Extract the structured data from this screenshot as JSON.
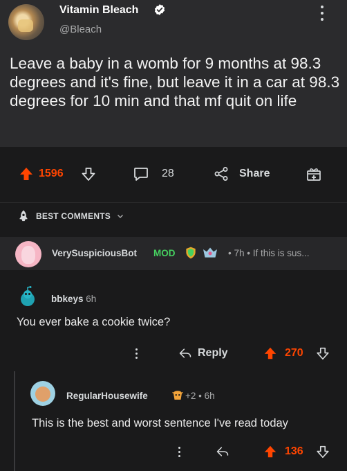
{
  "tweet": {
    "display_name": "Vitamin Bleach",
    "handle": "@Bleach",
    "text": "Leave a baby in a womb for 9 months at 98.3 degrees and it's fine, but leave it in a car at 98.3 degrees for 10 min and that mf quit on life"
  },
  "post_actions": {
    "upvotes": "1596",
    "comments": "28",
    "share_label": "Share"
  },
  "best_comments": {
    "label": "BEST COMMENTS"
  },
  "comments": [
    {
      "username": "VerySuspiciousBot",
      "flair": "MOD",
      "meta": "• 7h • If this is sus..."
    },
    {
      "username": "bbkeys",
      "age": "6h",
      "text": "You ever bake a cookie twice?",
      "reply_label": "Reply",
      "score": "270"
    },
    {
      "username": "RegularHousewife",
      "meta": "+2 • 6h",
      "text": "This is the best and worst sentence I've read today",
      "score": "136"
    }
  ],
  "colors": {
    "upvote": "#ff4500",
    "mod": "#46d160",
    "verified": "#ffffff"
  }
}
